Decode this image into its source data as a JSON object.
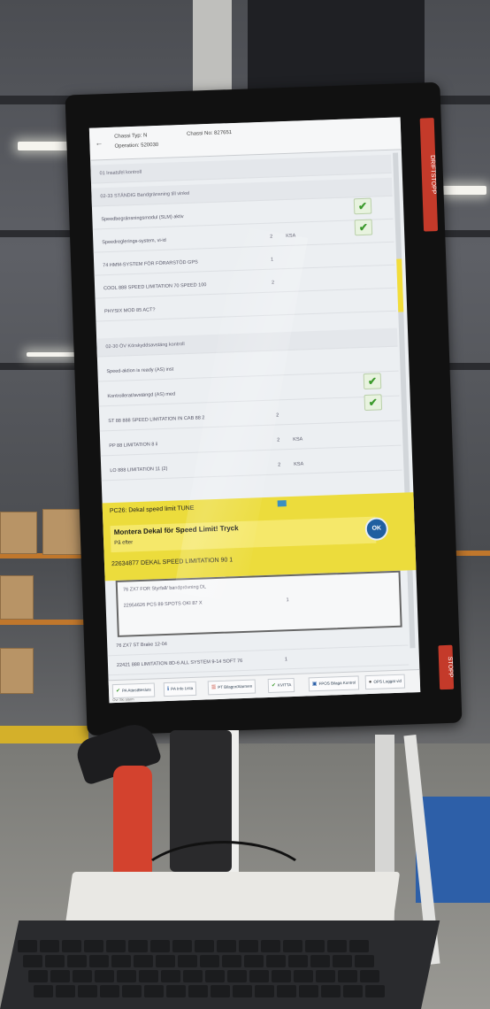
{
  "screen": {
    "header": {
      "line1": "Chassi Typ: N",
      "line2": "Operation: 520030",
      "line3": "Chassi No: 827651"
    },
    "rows": [
      {
        "label": "01 Insatsfel kontroll",
        "value": "",
        "section": true
      },
      {
        "label": "02-33 STÄNDIG Bandgränsning till vinkel",
        "value": "",
        "section": true
      },
      {
        "label": "Speedbegränsningsmodul (SLM) aktiv",
        "value": ""
      },
      {
        "label": "Speedreglerings-system, vi-id",
        "value": "2",
        "value2": "KSA"
      },
      {
        "label": "74 HMM-SYSTEM FÖR FÖRARSTÖD GPS",
        "value": "1"
      },
      {
        "label": "COOL 888 SPEED LIMITATION 70 SPEED 100",
        "value": "2"
      },
      {
        "label": "PHYSIX MOD 85 ACT?",
        "value": ""
      },
      {
        "label": "02-30 ÖV Körskyddsavstäng kontroll",
        "value": "",
        "section": true
      },
      {
        "label": "Speed-aktion is ready (AS) inst",
        "value": ""
      },
      {
        "label": "Kontrollerat/avstängd (AS) med",
        "value": ""
      },
      {
        "label": "ST 88 888 SPEED LIMITATION IN CAB 88 2",
        "value": "2"
      },
      {
        "label": "PP 88 LIMITATION 8 ii",
        "value": "2",
        "value2": "KSA"
      },
      {
        "label": "LO 888 LIMITATION 11 (2)",
        "value": "2",
        "value2": "KSA"
      }
    ],
    "highlight": {
      "title": "PC26: Dekal speed limit TUNE",
      "main": "Montera Dekal för Speed Limit! Tryck",
      "sub": "På efter",
      "ok": "OK",
      "bottom": "22634877 DEKAL SPEED LIMITATION 90   1"
    },
    "panel_rows": [
      {
        "label": "76 ZX7 FOR Styrfall/ bandprövning DL",
        "value": ""
      },
      {
        "label": "22954626 PCS 89 SPOTS OKI 87 X",
        "value": "1"
      },
      {
        "label": "76 ZX7 ST Brake 12-04",
        "value": ""
      },
      {
        "label": "22421 888 LIMITATION 8D-6 ALL SYSTEM 9-14 SOFT 76",
        "value": "1"
      }
    ],
    "footer": {
      "buttons": [
        {
          "icon": "check-icon",
          "label": "PA AttestBesluts"
        },
        {
          "icon": "info-icon",
          "label": "PA Info Lista"
        },
        {
          "icon": "list-icon",
          "label": "PT Bilagor/Alarmen"
        },
        {
          "icon": "check-icon",
          "label": "KVITTA"
        },
        {
          "icon": "doc-icon",
          "label": "FPOS Bilaga Kontrol"
        },
        {
          "icon": "user-icon",
          "label": "OPS Loggat vid"
        }
      ],
      "sub": "Ovr  Ski alarm"
    },
    "side_labels": {
      "top": "DRIFTSTOPP",
      "bottom": "STOPP"
    }
  },
  "colors": {
    "highlight": "#ecdc3c",
    "check": "#3c9a2c",
    "ok_button": "#1f5fa0",
    "badge": "#c43a2a"
  }
}
